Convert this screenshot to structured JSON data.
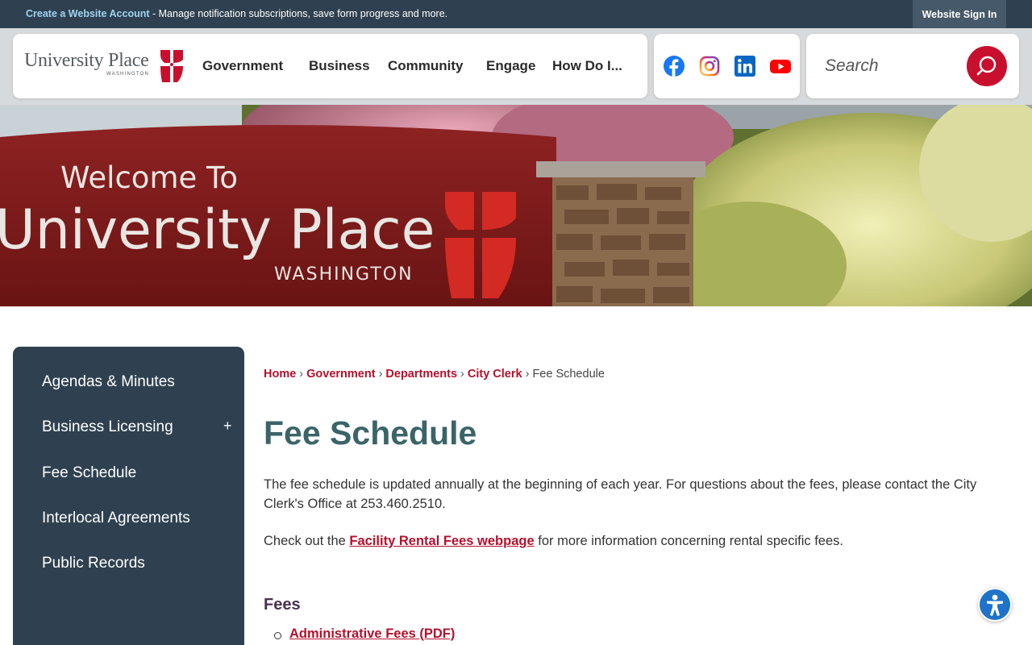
{
  "topbar": {
    "account_link": "Create a Website Account",
    "account_desc": " - Manage notification subscriptions, save form progress and more.",
    "signin": "Website Sign In"
  },
  "logo": {
    "name": "University Place",
    "sub": "WASHINGTON"
  },
  "nav": [
    "Government",
    "Business",
    "Community",
    "Engage",
    "How Do I..."
  ],
  "social": [
    "facebook-icon",
    "instagram-icon",
    "linkedin-icon",
    "youtube-icon"
  ],
  "search": {
    "placeholder": "Search"
  },
  "banner": {
    "line1": "Welcome To",
    "line2": "University Place",
    "line3": "WASHINGTON"
  },
  "sidebar": {
    "items": [
      "Agendas & Minutes",
      "Business Licensing",
      "Fee Schedule",
      "Interlocal Agreements",
      "Public Records"
    ],
    "expand_symbol": "+"
  },
  "breadcrumb": {
    "links": [
      "Home",
      "Government",
      "Departments",
      "City Clerk"
    ],
    "current": "Fee Schedule",
    "separator": "›"
  },
  "page": {
    "title": "Fee Schedule",
    "intro": "The fee schedule is updated annually at the beginning of each year. For questions about the fees, please contact the City Clerk's Office at 253.460.2510.",
    "check_prefix": "Check out the ",
    "check_link": "Facility Rental Fees webpage",
    "check_suffix": " for more information concerning rental specific fees.",
    "fees_heading": "Fees",
    "fee_items": [
      "Administrative Fees (PDF)"
    ]
  },
  "colors": {
    "brand_red": "#c8102e",
    "navy": "#2f4150",
    "title_teal": "#3a6468",
    "link_red": "#b3112c"
  }
}
